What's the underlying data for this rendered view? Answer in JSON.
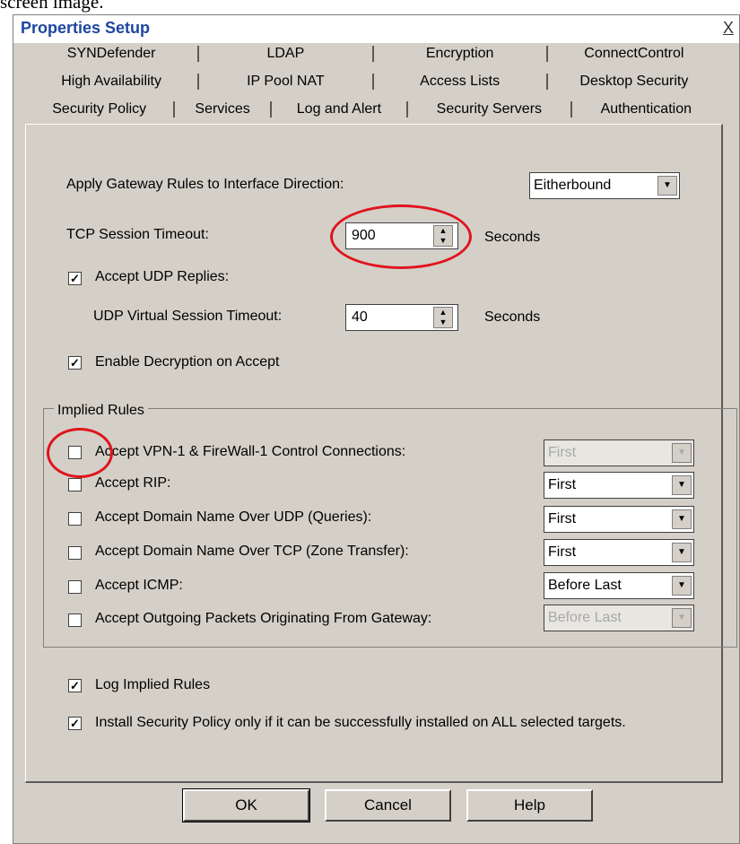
{
  "caption_cut": "screen image.",
  "window": {
    "title": "Properties Setup",
    "close_label": "X"
  },
  "tabs": {
    "row1": [
      "SYNDefender",
      "LDAP",
      "Encryption",
      "ConnectControl"
    ],
    "row2": [
      "High Availability",
      "IP Pool NAT",
      "Access Lists",
      "Desktop Security"
    ],
    "row3": [
      "Security Policy",
      "Services",
      "Log and Alert",
      "Security Servers",
      "Authentication"
    ]
  },
  "general": {
    "apply_label": "Apply Gateway Rules to Interface Direction:",
    "apply_value": "Eitherbound",
    "tcp_label": "TCP Session Timeout:",
    "tcp_value": "900",
    "tcp_unit": "Seconds",
    "udp_replies_label": "Accept UDP Replies:",
    "udp_timeout_label": "UDP Virtual Session Timeout:",
    "udp_timeout_value": "40",
    "udp_unit": "Seconds",
    "decrypt_label": "Enable Decryption on Accept"
  },
  "implied": {
    "title": "Implied Rules",
    "rows": [
      {
        "label": "Accept VPN-1 & FireWall-1 Control Connections:",
        "value": "First",
        "checked": false,
        "disabled": true
      },
      {
        "label": "Accept RIP:",
        "value": "First",
        "checked": false,
        "disabled": false
      },
      {
        "label": "Accept Domain Name Over UDP (Queries):",
        "value": "First",
        "checked": false,
        "disabled": false
      },
      {
        "label": "Accept Domain Name Over TCP (Zone Transfer):",
        "value": "First",
        "checked": false,
        "disabled": false
      },
      {
        "label": "Accept ICMP:",
        "value": "Before Last",
        "checked": false,
        "disabled": false
      },
      {
        "label": "Accept Outgoing Packets Originating From Gateway:",
        "value": "Before Last",
        "checked": false,
        "disabled": true
      }
    ]
  },
  "bottom": {
    "log_label": "Log Implied Rules",
    "install_label": "Install Security Policy only if it can be successfully installed on ALL selected targets."
  },
  "buttons": {
    "ok": "OK",
    "cancel": "Cancel",
    "help": "Help"
  }
}
